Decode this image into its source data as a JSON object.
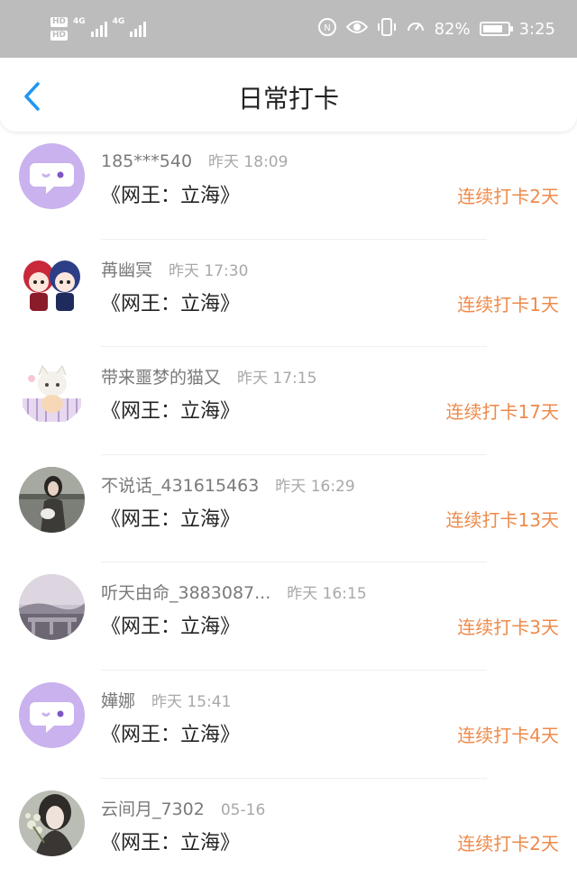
{
  "status_bar": {
    "hd_1": "HD",
    "hd_2": "HD",
    "network_1": "4G",
    "network_2": "4G",
    "battery_percent": "82%",
    "battery_level": 0.82,
    "time": "3:25"
  },
  "header": {
    "title": "日常打卡",
    "back_icon": "chevron-left-icon"
  },
  "colors": {
    "accent_blue": "#2196f3",
    "streak_orange": "#ee8a4a",
    "status_bar_bg": "#bcbcbc"
  },
  "items": [
    {
      "name": "185***540",
      "time": "昨天 18:09",
      "book": "《网王：立海》",
      "streak": "连续打卡2天",
      "avatar": "chat-bubble-avatar"
    },
    {
      "name": "苒幽冥",
      "time": "昨天 17:30",
      "book": "《网王：立海》",
      "streak": "连续打卡1天",
      "avatar": "anime-duo-avatar"
    },
    {
      "name": "带来噩梦的猫又",
      "time": "昨天 17:15",
      "book": "《网王：立海》",
      "streak": "连续打卡17天",
      "avatar": "anime-cat-avatar"
    },
    {
      "name": "不说话_431615463",
      "time": "昨天 16:29",
      "book": "《网王：立海》",
      "streak": "连续打卡13天",
      "avatar": "photo-girl-avatar"
    },
    {
      "name": "听天由命_3883087...",
      "time": "昨天 16:15",
      "book": "《网王：立海》",
      "streak": "连续打卡3天",
      "avatar": "landscape-avatar"
    },
    {
      "name": "嬅娜",
      "time": "昨天 15:41",
      "book": "《网王：立海》",
      "streak": "连续打卡4天",
      "avatar": "chat-bubble-avatar"
    },
    {
      "name": "云间月_7302",
      "time": "05-16",
      "book": "《网王：立海》",
      "streak": "连续打卡2天",
      "avatar": "photo-girl-flowers-avatar"
    }
  ]
}
